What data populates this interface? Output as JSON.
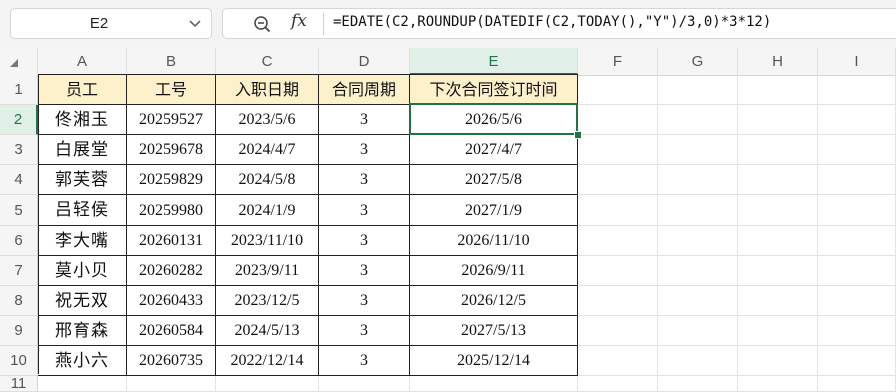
{
  "name_box": {
    "value": "E2"
  },
  "formula_bar": {
    "fx_label": "fx",
    "formula": "=EDATE(C2,ROUNDUP(DATEDIF(C2,TODAY(),\"Y\")/3,0)*3*12)"
  },
  "columns": [
    "A",
    "B",
    "C",
    "D",
    "E",
    "F",
    "G",
    "H",
    "I"
  ],
  "active_column": "E",
  "rows": [
    "1",
    "2",
    "3",
    "4",
    "5",
    "6",
    "7",
    "8",
    "9",
    "10",
    "11"
  ],
  "active_row": "2",
  "table": {
    "headers": [
      "员工",
      "工号",
      "入职日期",
      "合同周期",
      "下次合同签订时间"
    ],
    "records": [
      [
        "佟湘玉",
        "20259527",
        "2023/5/6",
        "3",
        "2026/5/6"
      ],
      [
        "白展堂",
        "20259678",
        "2024/4/7",
        "3",
        "2027/4/7"
      ],
      [
        "郭芙蓉",
        "20259829",
        "2024/5/8",
        "3",
        "2027/5/8"
      ],
      [
        "吕轻侯",
        "20259980",
        "2024/1/9",
        "3",
        "2027/1/9"
      ],
      [
        "李大嘴",
        "20260131",
        "2023/11/10",
        "3",
        "2026/11/10"
      ],
      [
        "莫小贝",
        "20260282",
        "2023/9/11",
        "3",
        "2026/9/11"
      ],
      [
        "祝无双",
        "20260433",
        "2023/12/5",
        "3",
        "2026/12/5"
      ],
      [
        "邢育森",
        "20260584",
        "2024/5/13",
        "3",
        "2027/5/13"
      ],
      [
        "燕小六",
        "20260735",
        "2022/12/14",
        "3",
        "2025/12/14"
      ]
    ]
  },
  "colors": {
    "header_fill": "#fdf1cc",
    "selection": "#217346",
    "active_header_bg": "#e1f0e7"
  },
  "icons": {
    "name_box_dropdown": "chevron-down-icon",
    "zoom": "zoom-icon",
    "function": "fx-icon"
  }
}
